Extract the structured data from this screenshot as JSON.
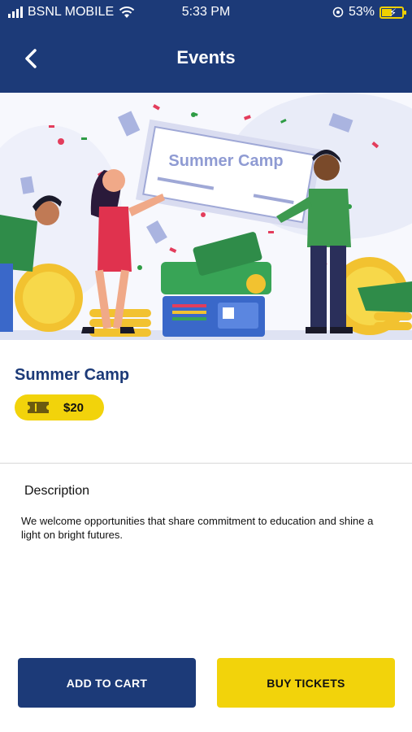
{
  "status_bar": {
    "carrier": "BSNL MOBILE",
    "time": "5:33 PM",
    "battery": "53%"
  },
  "header": {
    "title": "Events",
    "back_icon": "chevron-left-icon"
  },
  "hero": {
    "check_text": "Summer Camp"
  },
  "event": {
    "title": "Summer Camp",
    "price": "$20",
    "price_icon": "ticket-icon"
  },
  "description": {
    "heading": "Description",
    "body": "We welcome opportunities that share commitment to education and shine a light on bright futures."
  },
  "actions": {
    "add_to_cart": "ADD TO CART",
    "buy_tickets": "BUY TICKETS"
  },
  "colors": {
    "primary": "#1c3a78",
    "accent": "#f2d30b"
  }
}
